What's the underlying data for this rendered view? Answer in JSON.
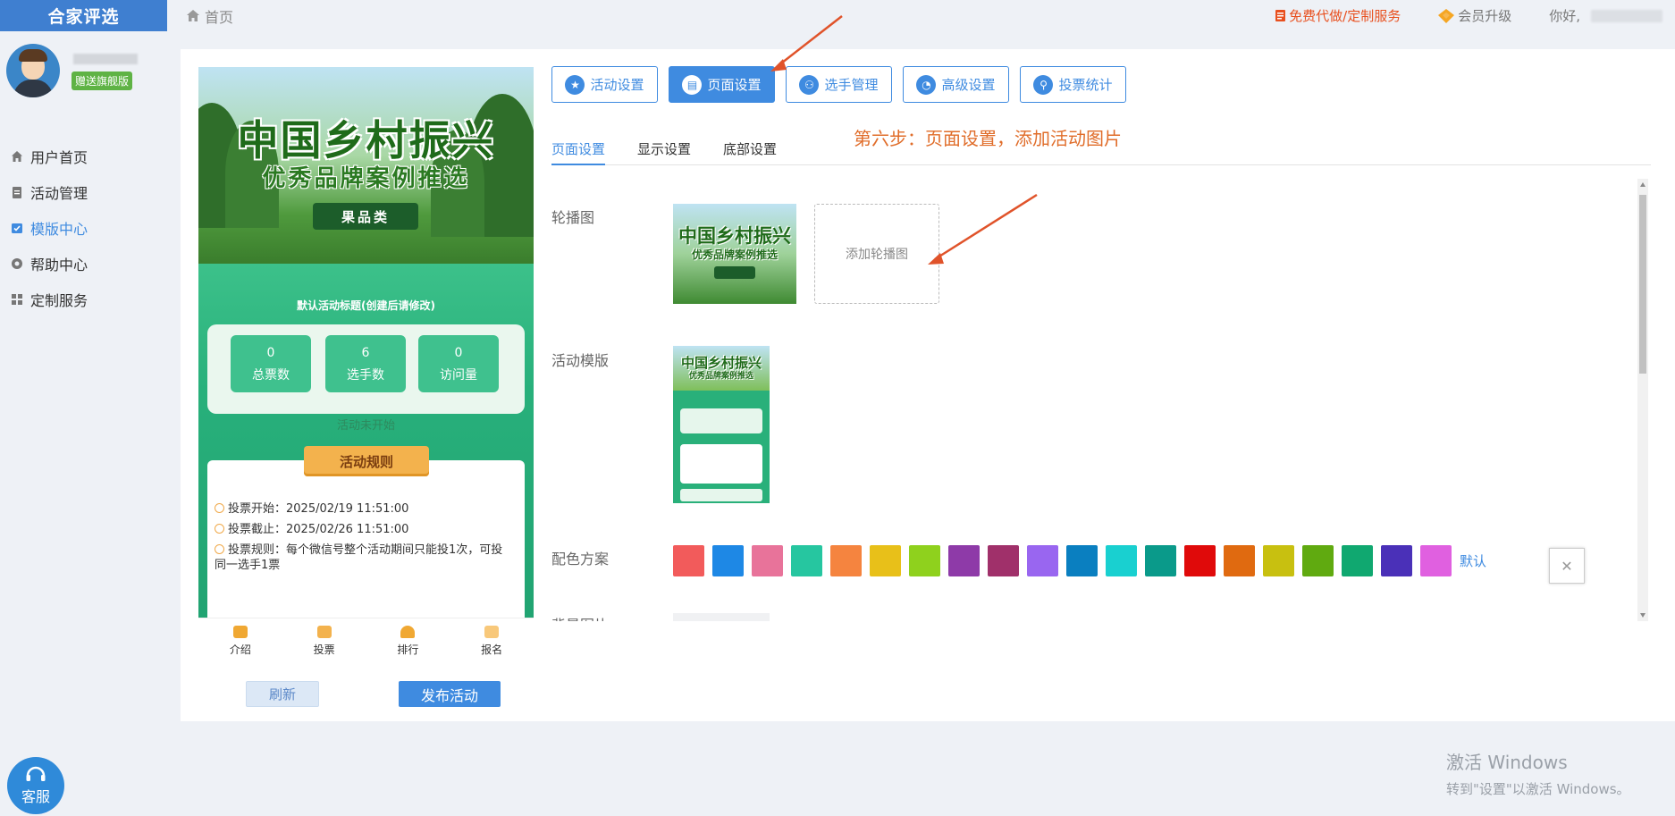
{
  "logo": {
    "text": "合家评选"
  },
  "breadcrumb": {
    "home": "首页"
  },
  "topbar": {
    "free_service": "免费代做/定制服务",
    "vip": "会员升级",
    "hello": "你好,"
  },
  "user": {
    "badge": "赠送旗舰版"
  },
  "sidebar": {
    "items": [
      {
        "label": "用户首页",
        "icon": "home-icon"
      },
      {
        "label": "活动管理",
        "icon": "clipboard-icon"
      },
      {
        "label": "模版中心",
        "icon": "template-icon",
        "active": true
      },
      {
        "label": "帮助中心",
        "icon": "help-icon"
      },
      {
        "label": "定制服务",
        "icon": "grid-icon"
      }
    ]
  },
  "preview": {
    "banner_title": "中国乡村振兴",
    "banner_subtitle": "优秀品牌案例推选",
    "banner_tag": "果品类",
    "activity_title": "默认活动标题(创建后请修改)",
    "stats": [
      {
        "value": "0",
        "label": "总票数"
      },
      {
        "value": "6",
        "label": "选手数"
      },
      {
        "value": "0",
        "label": "访问量"
      }
    ],
    "status": "活动未开始",
    "rules_title": "活动规则",
    "rules": [
      "投票开始：2025/02/19 11:51:00",
      "投票截止：2025/02/26 11:51:00",
      "投票规则：每个微信号整个活动期间只能投1次，可投同一选手1票"
    ],
    "tabbar": [
      "介绍",
      "投票",
      "排行",
      "报名"
    ],
    "refresh": "刷新",
    "publish": "发布活动"
  },
  "tabs": [
    {
      "label": "活动设置",
      "icon": "star-icon"
    },
    {
      "label": "页面设置",
      "icon": "document-icon",
      "active": true
    },
    {
      "label": "选手管理",
      "icon": "users-icon"
    },
    {
      "label": "高级设置",
      "icon": "pie-icon"
    },
    {
      "label": "投票统计",
      "icon": "key-icon"
    }
  ],
  "subtabs": [
    {
      "label": "页面设置",
      "active": true
    },
    {
      "label": "显示设置"
    },
    {
      "label": "底部设置"
    }
  ],
  "step_note": "第六步：页面设置，添加活动图片",
  "form": {
    "carousel_label": "轮播图",
    "add_carousel": "添加轮播图",
    "template_label": "活动模版",
    "color_label": "配色方案",
    "color_default": "默认",
    "bg_label": "背景图片",
    "colors": [
      "#f25b5b",
      "#1e88e5",
      "#e8739a",
      "#26c6a0",
      "#f5843f",
      "#e8c019",
      "#8fd11d",
      "#8e3aa8",
      "#a0306a",
      "#9966f0",
      "#0a7fc0",
      "#19d0d0",
      "#0a9a8a",
      "#e00a0a",
      "#e06a10",
      "#c8c010",
      "#60aa10",
      "#10a870",
      "#4a30b8",
      "#e060e0"
    ]
  },
  "service": {
    "label": "客服"
  },
  "watermark": {
    "line1": "激活 Windows",
    "line2": "转到\"设置\"以激活 Windows。"
  }
}
